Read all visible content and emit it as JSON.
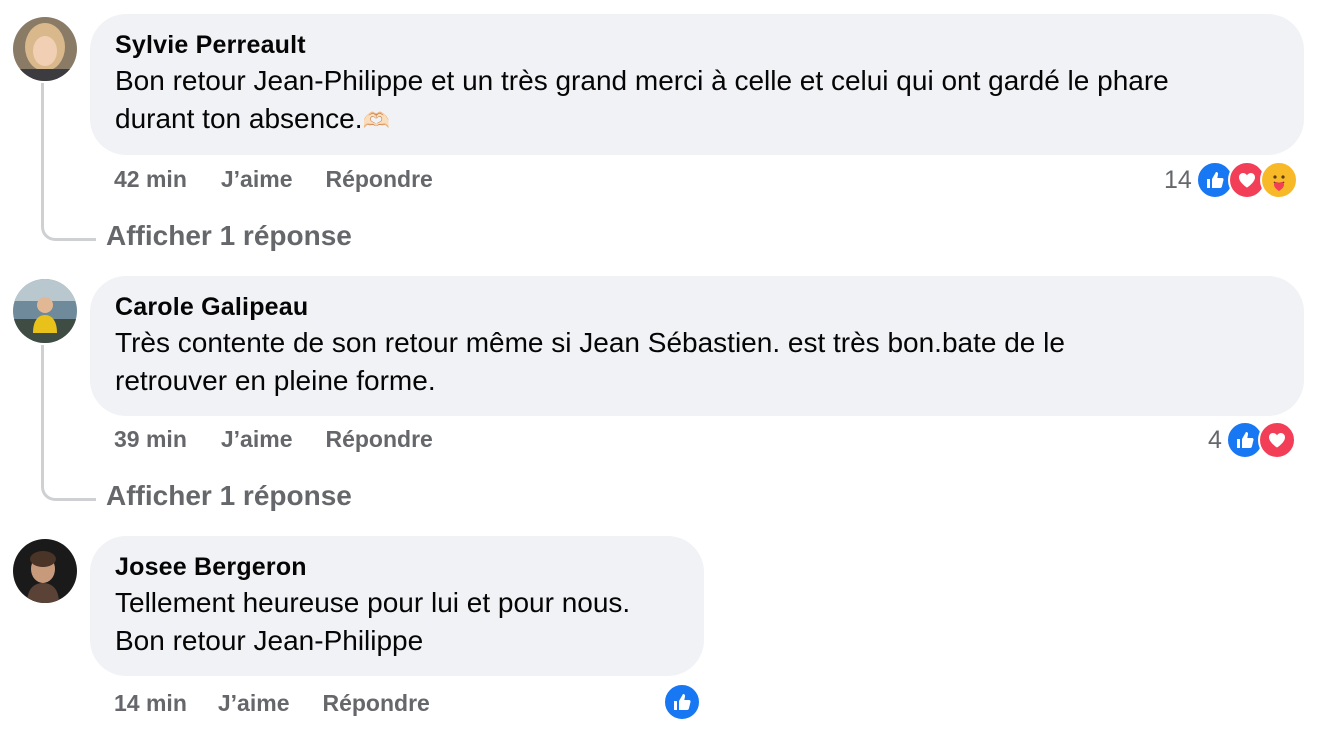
{
  "comments": [
    {
      "author": "Sylvie Perreault",
      "text_line1": "Bon retour Jean-Philippe et un très grand merci à celle et celui qui ont gardé le phare",
      "text_line2": "durant ton absence.",
      "emoji": "🫶🏻",
      "time": "42 min",
      "like_label": "J’aime",
      "reply_label": "Répondre",
      "reaction_count": "14",
      "reactions": [
        "like-icon",
        "love-icon",
        "care-icon"
      ],
      "replies_label": "Afficher 1 réponse"
    },
    {
      "author": "Carole Galipeau",
      "text_line1": "Très contente de son retour même si Jean Sébastien. est très bon.bate de le",
      "text_line2": "retrouver en pleine forme.",
      "time": "39 min",
      "like_label": "J’aime",
      "reply_label": "Répondre",
      "reaction_count": "4",
      "reactions": [
        "like-icon",
        "love-icon"
      ],
      "replies_label": "Afficher 1 réponse"
    },
    {
      "author": "Josee Bergeron",
      "text_line1": "Tellement heureuse pour lui et pour nous.",
      "text_line2": "Bon retour Jean-Philippe",
      "time": "14 min",
      "like_label": "J’aime",
      "reply_label": "Répondre",
      "reactions": [
        "like-icon"
      ]
    }
  ],
  "colors": {
    "bubble": "#f0f2f5",
    "secondary_text": "#65676b",
    "like": "#1877f2",
    "love": "#f33e58",
    "care": "#f7b928"
  }
}
